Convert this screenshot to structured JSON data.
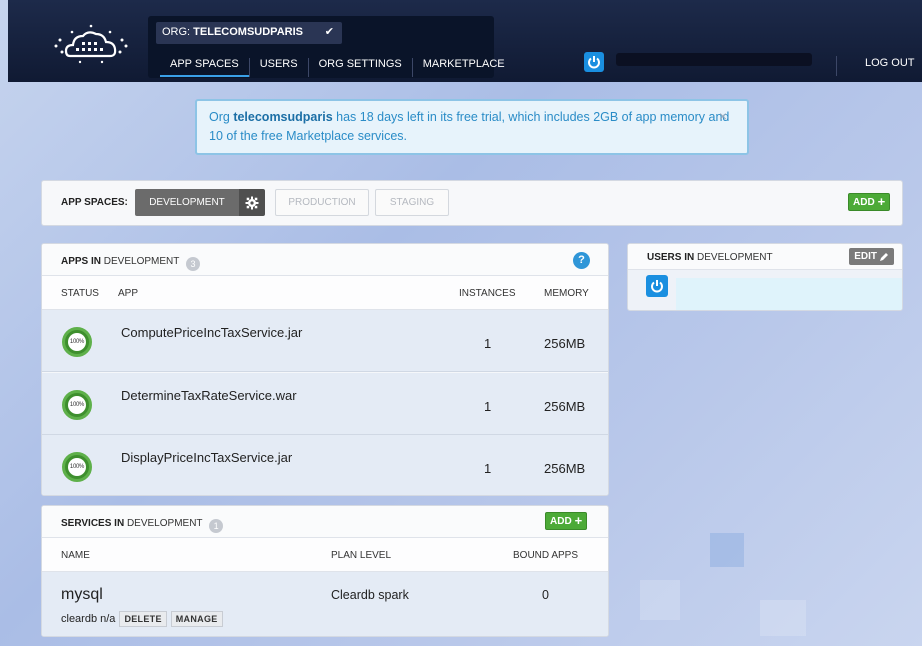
{
  "header": {
    "org_prefix": "ORG: ",
    "org_name": "TELECOMSUDPARIS",
    "nav": [
      "APP SPACES",
      "USERS",
      "ORG SETTINGS",
      "MARKETPLACE"
    ],
    "logout": "LOG OUT"
  },
  "notice": {
    "pre": "Org ",
    "org": "telecomsudparis",
    "text": " has 18 days left in its free trial, which includes 2GB of app memory and 10 of the free Marketplace services.",
    "close": "×"
  },
  "spaces": {
    "label": "APP SPACES:",
    "items": [
      "DEVELOPMENT",
      "PRODUCTION",
      "STAGING"
    ],
    "add": "ADD"
  },
  "apps": {
    "title_bold": "APPS IN",
    "title_rest": " DEVELOPMENT",
    "count": "3",
    "help": "?",
    "columns": [
      "STATUS",
      "APP",
      "INSTANCES",
      "MEMORY"
    ],
    "rows": [
      {
        "status": "100%",
        "name": "ComputePriceIncTaxService.jar",
        "instances": "1",
        "memory": "256MB"
      },
      {
        "status": "100%",
        "name": "DetermineTaxRateService.war",
        "instances": "1",
        "memory": "256MB"
      },
      {
        "status": "100%",
        "name": "DisplayPriceIncTaxService.jar",
        "instances": "1",
        "memory": "256MB"
      }
    ]
  },
  "services": {
    "title_bold": "SERVICES IN",
    "title_rest": " DEVELOPMENT",
    "count": "1",
    "add": "ADD",
    "columns": [
      "NAME",
      "PLAN LEVEL",
      "BOUND APPS"
    ],
    "row": {
      "name": "mysql",
      "sub": "cleardb n/a",
      "delete": "DELETE",
      "manage": "MANAGE",
      "plan": "Cleardb spark",
      "bound": "0"
    }
  },
  "users": {
    "title_bold": "USERS IN",
    "title_rest": " DEVELOPMENT",
    "edit": "EDIT"
  }
}
